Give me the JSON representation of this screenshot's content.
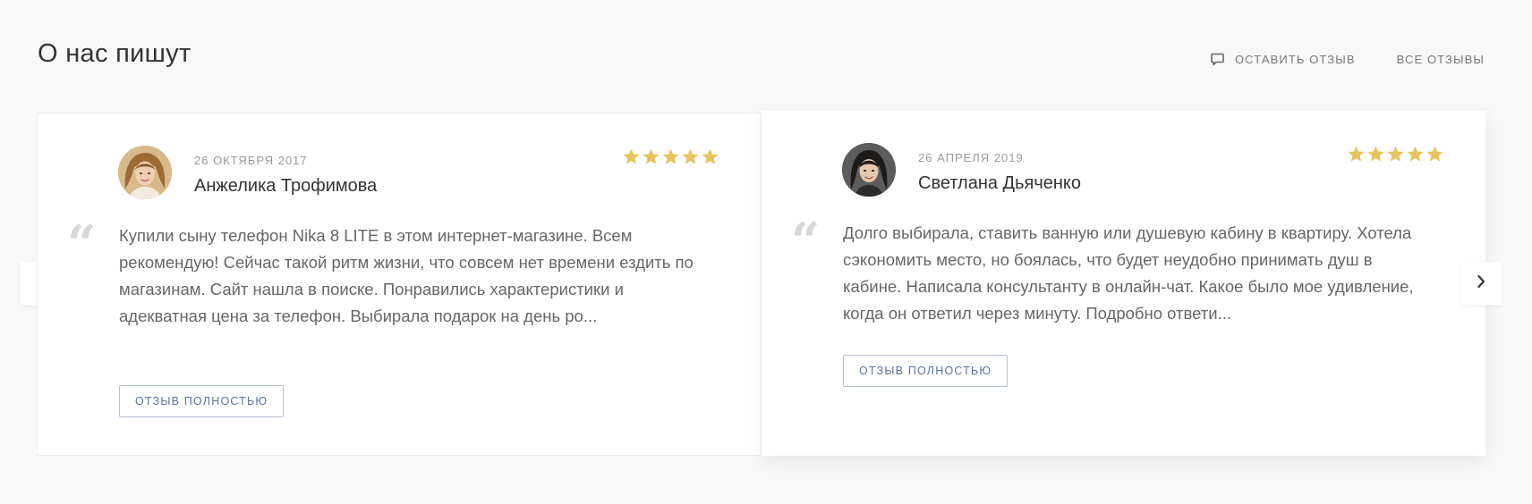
{
  "header": {
    "title": "О нас пишут",
    "leave_review_label": "ОСТАВИТЬ ОТЗЫВ",
    "all_reviews_label": "ВСЕ ОТЗЫВЫ"
  },
  "reviews": [
    {
      "date": "26 ОКТЯБРЯ 2017",
      "author": "Анжелика Трофимова",
      "rating": 5,
      "text": "Купили сыну телефон Nika 8 LITE в этом интернет-магазине. Всем рекомендую! Сейчас такой ритм жизни, что совсем нет времени ездить по магазинам. Сайт нашла в поиске. Понравились характеристики и адекватная цена за телефон. Выбирала подарок на день ро...",
      "button_label": "ОТЗЫВ ПОЛНОСТЬЮ"
    },
    {
      "date": "26 АПРЕЛЯ 2019",
      "author": "Светлана Дьяченко",
      "rating": 5,
      "text": "Долго выбирала, ставить ванную или душевую кабину в квартиру. Хотела сэкономить место, но боялась, что будет неудобно принимать душ в кабине. Написала консультанту в онлайн-чат. Какое было мое удивление, когда он ответил через минуту. Подробно ответи...",
      "button_label": "ОТЗЫВ ПОЛНОСТЬЮ"
    }
  ],
  "quote_glyph": "“",
  "colors": {
    "background": "#f8f8f8",
    "card": "#ffffff",
    "star": "#e6c35c",
    "button_text": "#5c72a6",
    "button_border": "#b3bfd6"
  },
  "icons": {
    "leave_review": "comment-icon",
    "prev": "chevron-left-icon",
    "next": "chevron-right-icon",
    "star": "star-icon"
  }
}
